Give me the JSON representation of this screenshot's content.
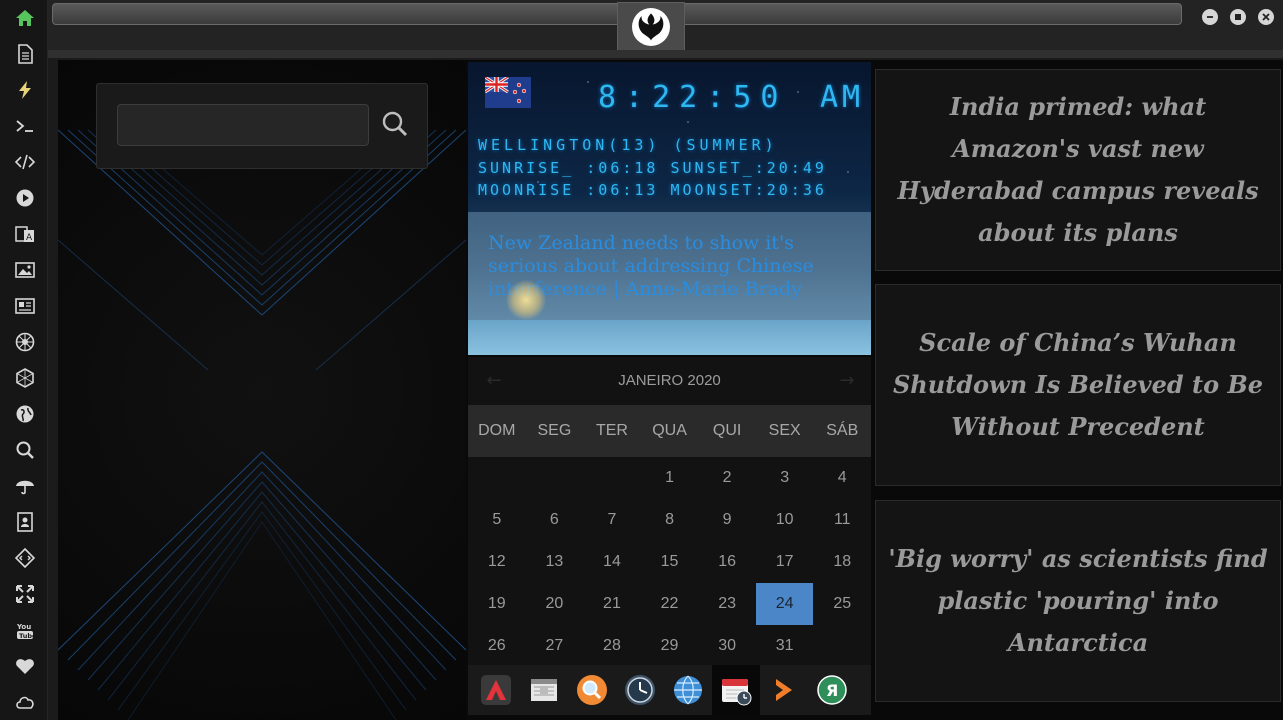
{
  "sidebar": {
    "icons": [
      "home-icon",
      "document-icon",
      "lightning-icon",
      "terminal-icon",
      "code-icon",
      "play-icon",
      "translate-icon",
      "image-icon",
      "newspaper-icon",
      "rebel-icon",
      "hexagon-icon",
      "globe-icon",
      "search-icon",
      "umbrella-icon",
      "contacts-icon",
      "diamond-code-icon",
      "expand-icon",
      "youtube-icon",
      "heart-icon",
      "cloud-icon"
    ],
    "active_color": "#58c45c"
  },
  "search": {
    "value": "",
    "placeholder": ""
  },
  "clock": {
    "time": "8:22:50",
    "ampm": "AM",
    "city": "WELLINGTON(13) (SUMMER)",
    "sun": "SUNRISE_ :06:18 SUNSET_:20:49",
    "moon": "MOONRISE :06:13 MOONSET:20:36",
    "headline": "New Zealand needs to show it's serious about addressing Chinese interference | Anne-Marie Brady",
    "flag": "new-zealand-flag"
  },
  "calendar": {
    "month": "JANEIRO 2020",
    "prev_label": "←",
    "next_label": "→",
    "day_names": [
      "DOM",
      "SEG",
      "TER",
      "QUA",
      "QUI",
      "SEX",
      "SÁB"
    ],
    "weeks": [
      [
        "",
        "",
        "",
        "1",
        "2",
        "3",
        "4"
      ],
      [
        "5",
        "6",
        "7",
        "8",
        "9",
        "10",
        "11"
      ],
      [
        "12",
        "13",
        "14",
        "15",
        "16",
        "17",
        "18"
      ],
      [
        "19",
        "20",
        "21",
        "22",
        "23",
        "24",
        "25"
      ],
      [
        "26",
        "27",
        "28",
        "29",
        "30",
        "31",
        ""
      ]
    ],
    "today": "24",
    "today_color": "#4a86c8"
  },
  "dock": {
    "icons": [
      "red-app-icon",
      "calendar-sheet-icon",
      "magnifier-icon",
      "clock-icon",
      "globe-icon",
      "calendar-clock-icon",
      "arrow-icon",
      "yandex-icon"
    ]
  },
  "news": [
    "India primed: what Amazon's vast new Hyderabad campus reveals about its plans",
    "Scale of China’s Wuhan Shutdown Is Believed to Be Without Precedent",
    "'Big worry' as scientists find plastic 'pouring' into Antarctica"
  ]
}
